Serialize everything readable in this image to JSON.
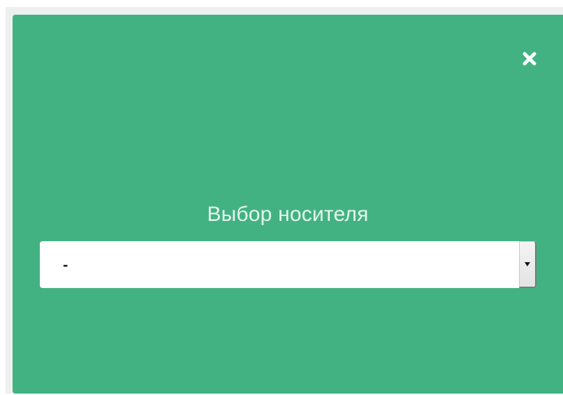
{
  "dialog": {
    "title": "Выбор носителя",
    "close_icon": "close-icon",
    "select": {
      "value": "-",
      "arrow_icon": "chevron-down-icon"
    }
  },
  "colors": {
    "dialog_background": "#43b282",
    "title_text": "#e6f6ee",
    "select_background": "#ffffff"
  }
}
